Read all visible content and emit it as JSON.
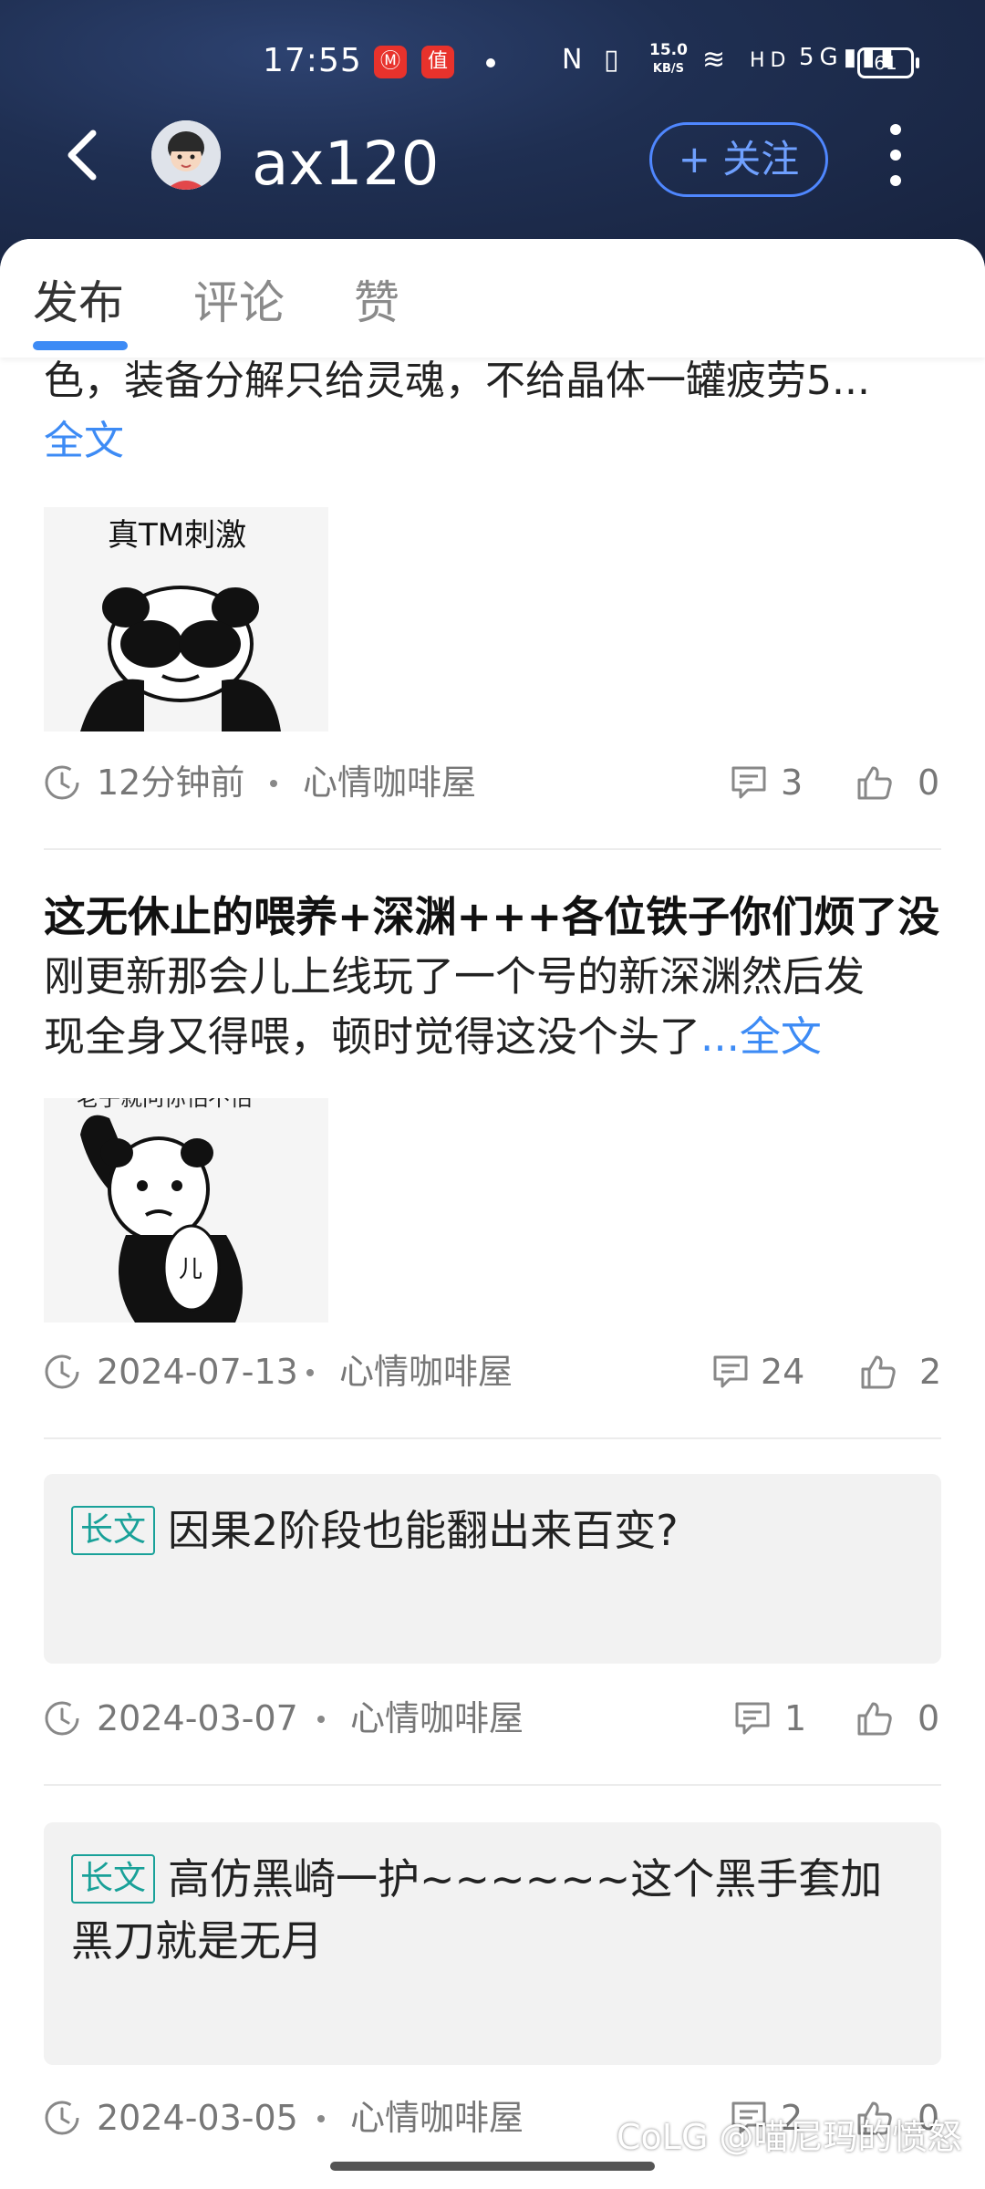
{
  "status_bar": {
    "time": "17:55",
    "app_icons": [
      "netease-music-icon",
      "smzdm-icon"
    ],
    "badge_1": "Ⓜ",
    "badge_2": "值",
    "net_speed_top": "15.0",
    "net_speed_unit": "KB/S",
    "indicators": "N  ▯  ᯤ HD 5G▮▮▮",
    "battery": "61"
  },
  "header": {
    "username": "ax120",
    "follow_label": "+ 关注"
  },
  "tabs": [
    {
      "label": "发布",
      "active": true
    },
    {
      "label": "评论",
      "active": false
    },
    {
      "label": "赞",
      "active": false
    }
  ],
  "posts": [
    {
      "text": "色，装备分解只给灵魂，不给晶体一罐疲劳5...",
      "more": "全文",
      "image_caption": "真TM刺激",
      "time": "12分钟前",
      "board": "心情咖啡屋",
      "comments": "3",
      "likes": "0"
    },
    {
      "title": "这无休止的喂养+深渊+++各位铁子你们烦了没",
      "text_1": "刚更新那会儿上线玩了一个号的新深渊然后发",
      "text_2": "现全身又得喂，顿时觉得这没个头了",
      "more": "...全文",
      "image_caption": "老子就问你怕不怕",
      "time": "2024-07-13",
      "board": "心情咖啡屋",
      "comments": "24",
      "likes": "2"
    },
    {
      "tag": "长文",
      "title": "因果2阶段也能翻出来百变?",
      "time": "2024-03-07",
      "board": "心情咖啡屋",
      "comments": "1",
      "likes": "0"
    },
    {
      "tag": "长文",
      "title": "高仿黑崎一护~~~~~~这个黑手套加黑刀就是无月",
      "time": "2024-03-05",
      "board": "心情咖啡屋",
      "comments": "2",
      "likes": "0"
    }
  ],
  "watermark": "CoLG @喵尼玛的愤怒",
  "colors": {
    "accent": "#3d8bf5",
    "tag": "#19a199",
    "header_bg": "#1f2f52"
  }
}
